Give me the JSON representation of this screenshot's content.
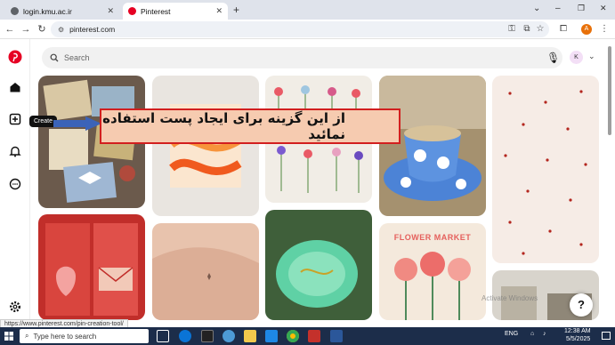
{
  "browser": {
    "tabs": [
      {
        "title": "login.kmu.ac.ir",
        "favicon_color": "#5f6368",
        "active": false
      },
      {
        "title": "Pinterest",
        "favicon_color": "#e60023",
        "active": true
      }
    ],
    "new_tab": "+",
    "url": "pinterest.com",
    "window_controls": {
      "minimize": "–",
      "maximize": "❐",
      "close": "✕"
    },
    "profile_initial": "A",
    "profile_color": "#e8710a"
  },
  "pinterest": {
    "accent": "#e60023",
    "search_placeholder": "Search",
    "avatar_initial": "K",
    "sidebar_items": [
      "home-icon",
      "create-icon",
      "notifications-icon",
      "messages-icon",
      "settings-icon"
    ],
    "tooltip": "Create",
    "help": "?"
  },
  "annotation": {
    "text": "از این گزینه برای ایجاد پست استفاده نمائید",
    "border_color": "#d21f1f",
    "fill_color": "#f6cbb0",
    "arrow_color": "#3b63b8"
  },
  "pins": {
    "flower_market_title": "FLOWER MARKET"
  },
  "watermark": "Activate Windows",
  "status_url": "https://www.pinterest.com/pin-creation-tool/",
  "taskbar": {
    "search_placeholder": "Type here to search",
    "language": "ENG",
    "time": "12:38 AM",
    "date": "5/5/2025"
  }
}
